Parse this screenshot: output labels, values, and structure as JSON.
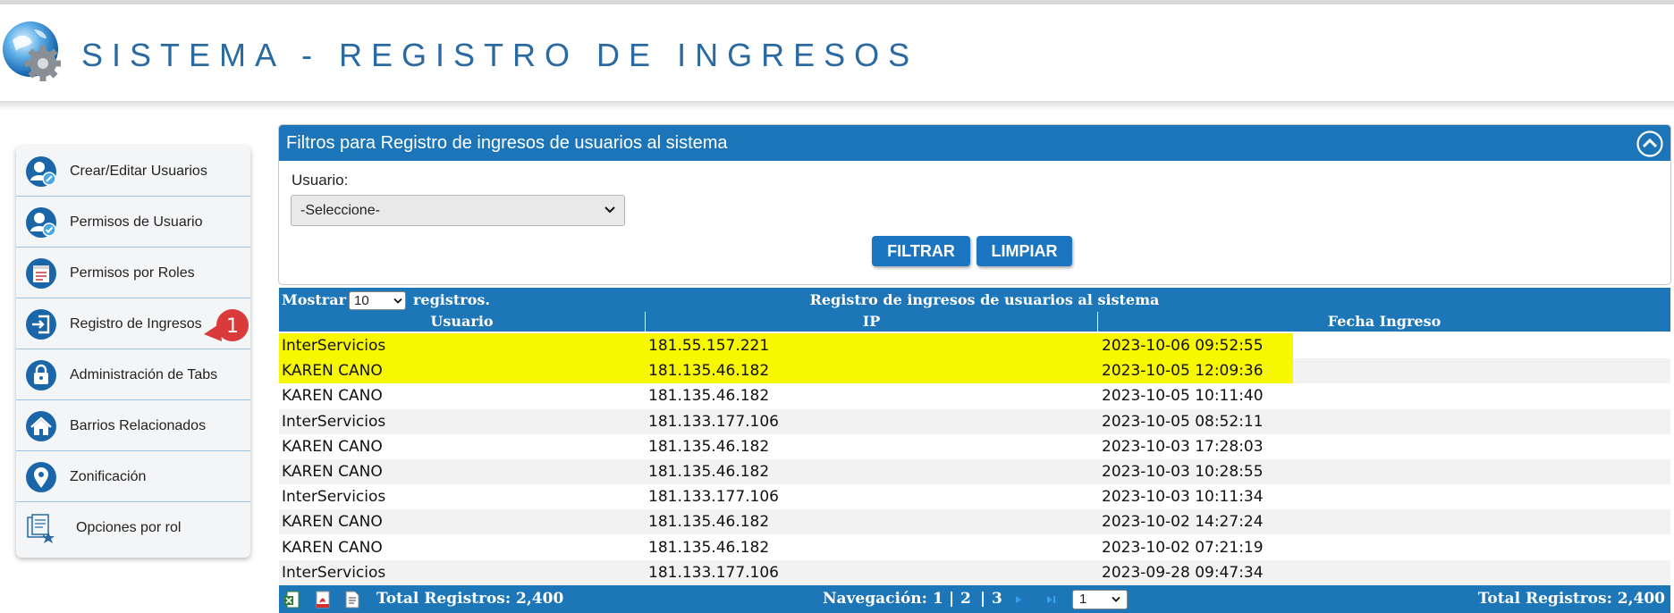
{
  "header": {
    "title": "SISTEMA - REGISTRO DE INGRESOS",
    "logo_icon": "globe-gear-logo"
  },
  "sidebar": {
    "items": [
      {
        "label": "Crear/Editar Usuarios",
        "icon": "user-edit-icon"
      },
      {
        "label": "Permisos de Usuario",
        "icon": "user-check-icon"
      },
      {
        "label": "Permisos por Roles",
        "icon": "role-list-icon"
      },
      {
        "label": "Registro de Ingresos",
        "icon": "login-door-icon"
      },
      {
        "label": "Administración de Tabs",
        "icon": "lock-tab-icon"
      },
      {
        "label": "Barrios Relacionados",
        "icon": "house-icon"
      },
      {
        "label": "Zonificación",
        "icon": "map-pin-icon"
      },
      {
        "label": "Opciones por rol",
        "icon": "documents-icon"
      }
    ],
    "badge": "1"
  },
  "filters": {
    "title": "Filtros para Registro de ingresos de usuarios al sistema",
    "user_label": "Usuario:",
    "user_selected": "-Seleccione-",
    "filter_button": "FILTRAR",
    "clear_button": "LIMPIAR"
  },
  "table": {
    "show_label": "Mostrar",
    "show_value": "10",
    "records_label": "registros.",
    "caption": "Registro de ingresos de usuarios al sistema",
    "columns": [
      "Usuario",
      "IP",
      "Fecha Ingreso"
    ],
    "rows": [
      {
        "user": "InterServicios",
        "ip": "181.55.157.221",
        "date": "2023-10-06 09:52:55",
        "highlight": true
      },
      {
        "user": "KAREN CANO",
        "ip": "181.135.46.182",
        "date": "2023-10-05 12:09:36",
        "highlight": true
      },
      {
        "user": "KAREN CANO",
        "ip": "181.135.46.182",
        "date": "2023-10-05 10:11:40",
        "highlight": false
      },
      {
        "user": "InterServicios",
        "ip": "181.133.177.106",
        "date": "2023-10-05 08:52:11",
        "highlight": false
      },
      {
        "user": "KAREN CANO",
        "ip": "181.135.46.182",
        "date": "2023-10-03 17:28:03",
        "highlight": false
      },
      {
        "user": "KAREN CANO",
        "ip": "181.135.46.182",
        "date": "2023-10-03 10:28:55",
        "highlight": false
      },
      {
        "user": "InterServicios",
        "ip": "181.133.177.106",
        "date": "2023-10-03 10:11:34",
        "highlight": false
      },
      {
        "user": "KAREN CANO",
        "ip": "181.135.46.182",
        "date": "2023-10-02 14:27:24",
        "highlight": false
      },
      {
        "user": "KAREN CANO",
        "ip": "181.135.46.182",
        "date": "2023-10-02 07:21:19",
        "highlight": false
      },
      {
        "user": "InterServicios",
        "ip": "181.133.177.106",
        "date": "2023-09-28 09:47:34",
        "highlight": false
      }
    ],
    "footer": {
      "total_left": "Total Registros: 2,400",
      "nav_label": "Navegación:",
      "pages": [
        "1",
        "2",
        "3"
      ],
      "separator": "|",
      "page_selected": "1",
      "total_right": "Total Registros: 2,400"
    }
  },
  "colors": {
    "brand_blue": "#1d76b8",
    "title_blue": "#2a6aa0",
    "highlight_yellow": "#f7f700",
    "badge_red": "#d93a3a"
  }
}
